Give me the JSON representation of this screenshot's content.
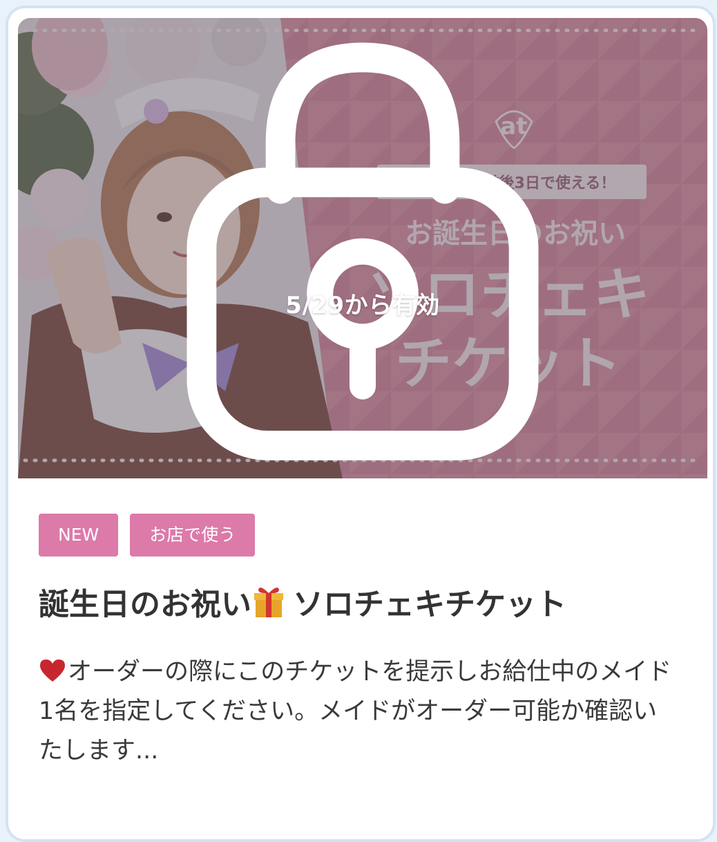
{
  "banner": {
    "lock_icon": "lock-icon",
    "valid_from": "5/29から有効",
    "image": {
      "logo_text": "at",
      "ribbon_text": "お誕生日の前後3日で使える！",
      "heading": "お誕生日のお祝い",
      "big_line1": "ソロチェキ",
      "big_line2": "チケット"
    }
  },
  "tags": [
    {
      "label": "NEW"
    },
    {
      "label": "お店で使う"
    }
  ],
  "title": {
    "before_icon": "誕生日のお祝い",
    "icon": "gift-icon",
    "after_icon": "ソロチェキチケット"
  },
  "description": {
    "icon": "heart-icon",
    "text": "オーダーの際にこのチケットを提示しお給仕中のメイド1名を指定してください。メイドがオーダー可能か確認いたします..."
  },
  "colors": {
    "tag_background": "#dc7aa9",
    "banner_pink": "#cf7f93",
    "page_background": "#e9f1fb",
    "card_border": "#d3e2f7"
  }
}
